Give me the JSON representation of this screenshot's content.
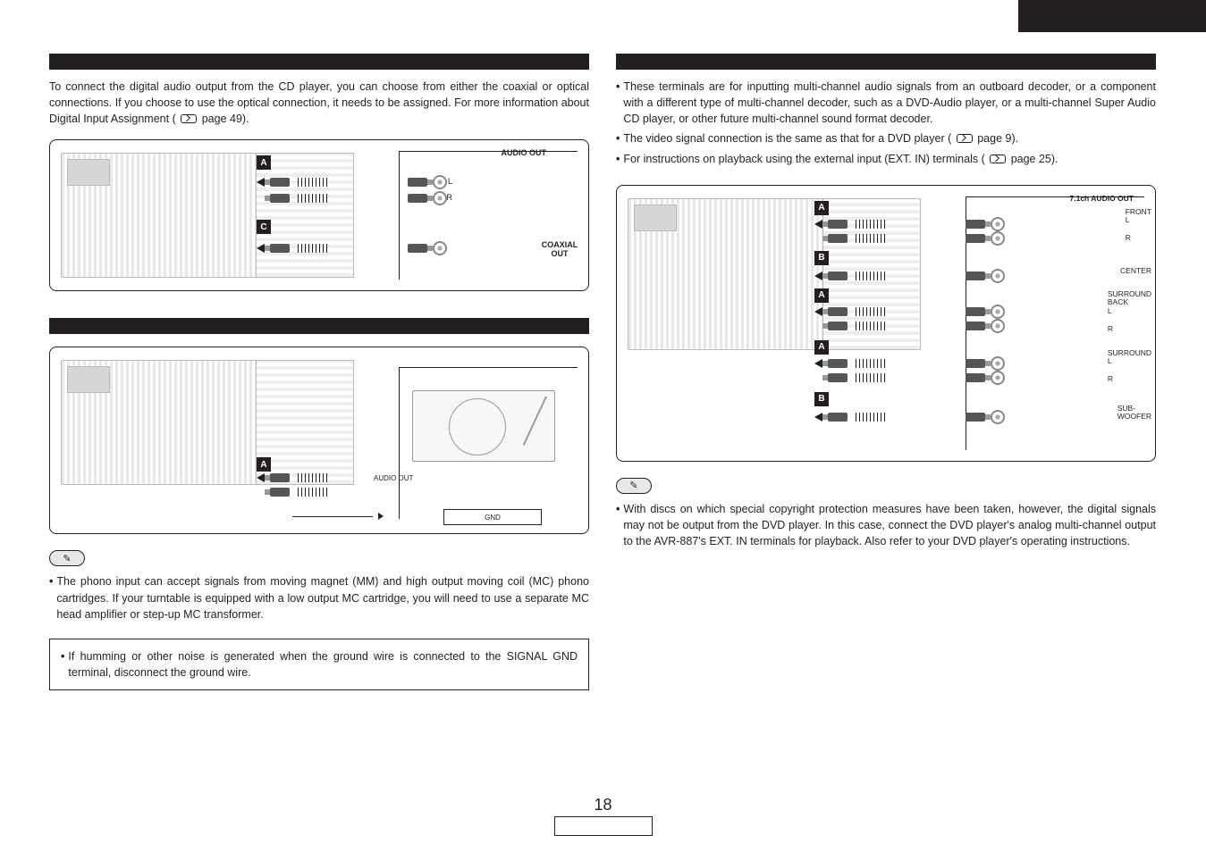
{
  "page_number": "18",
  "left": {
    "cd": {
      "intro_pre": "To connect the digital audio output from the CD player, you can choose from either the coaxial or optical connections. If you choose to use the optical connection, it needs to be assigned. For more information about Digital Input Assignment (",
      "intro_post": " page 49).",
      "labels": {
        "audio_out": "AUDIO OUT",
        "L": "L",
        "R": "R",
        "coax_out_line1": "COAXIAL",
        "coax_out_line2": "OUT",
        "marker_A": "A",
        "marker_C": "C"
      }
    },
    "phono": {
      "labels": {
        "audio_out": "AUDIO OUT",
        "gnd": "GND",
        "marker_A": "A"
      },
      "note_bullet": "The phono input can accept signals from moving magnet (MM) and high output moving coil (MC) phono cartridges. If your turntable is equipped with a low output MC cartridge, you will need to use a separate MC head amplifier or step-up MC transformer.",
      "hum_note": "If humming or other noise is generated when the ground wire is connected to the SIGNAL GND terminal, disconnect the ground wire."
    }
  },
  "right": {
    "ext": {
      "bullets": {
        "b1": "These terminals are for inputting multi-channel audio signals from an outboard decoder, or a component with a different type of multi-channel decoder, such as a DVD-Audio player, or a multi-channel Super Audio CD player, or other future multi-channel sound format decoder.",
        "b2_pre": "The video signal connection is the same as that for a DVD player (",
        "b2_post": " page 9).",
        "b3_pre": "For instructions on playback using the external input (EXT. IN) terminals (",
        "b3_post": " page 25)."
      },
      "labels": {
        "title": "7.1ch AUDIO OUT",
        "front": "FRONT",
        "L": "L",
        "R": "R",
        "center": "CENTER",
        "sback": "SURROUND\nBACK",
        "surround": "SURROUND",
        "sub": "SUB-\nWOOFER",
        "marker_A": "A",
        "marker_B": "B"
      },
      "note_bullet": "With discs on which special copyright protection measures have been taken, however, the digital signals may not be output from the DVD player. In this case, connect the DVD player's analog multi-channel output to the AVR-887's EXT. IN terminals for playback. Also refer to your DVD player's operating instructions."
    }
  }
}
